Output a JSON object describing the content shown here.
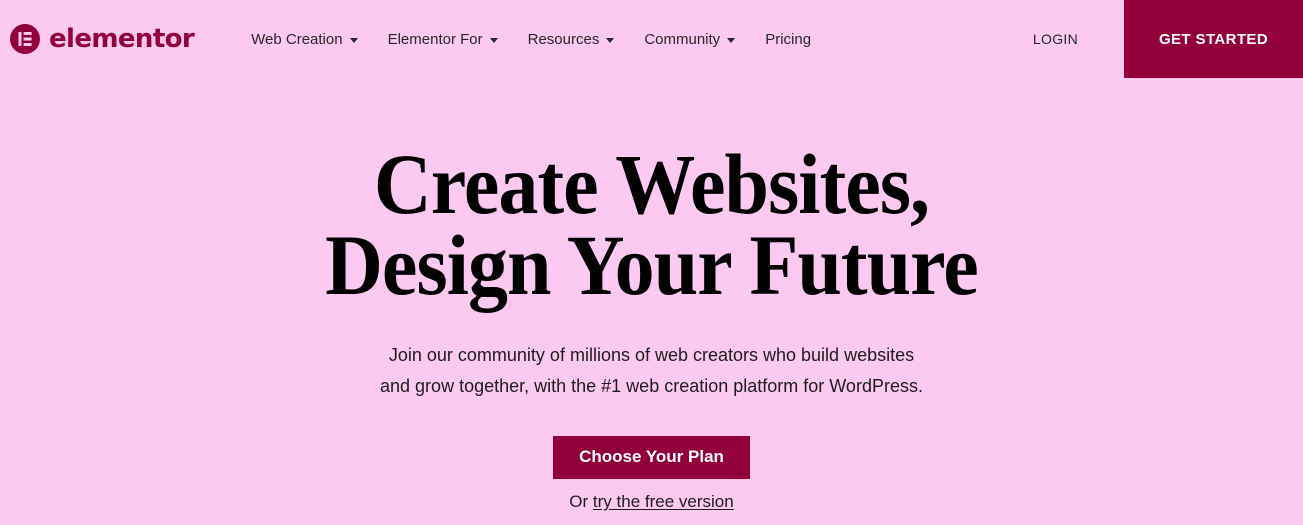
{
  "theme": {
    "background": "#fcc9f0",
    "brand_magenta": "#92003b",
    "text_dark": "#1c1c1c",
    "text_on_brand": "#ffffff"
  },
  "header": {
    "logo": {
      "icon": "elementor-logo-icon",
      "wordmark": "elementor"
    },
    "nav": [
      {
        "label": "Web Creation",
        "has_dropdown": true
      },
      {
        "label": "Elementor For",
        "has_dropdown": true
      },
      {
        "label": "Resources",
        "has_dropdown": true
      },
      {
        "label": "Community",
        "has_dropdown": true
      },
      {
        "label": "Pricing",
        "has_dropdown": false
      }
    ],
    "login_label": "LOGIN",
    "get_started_label": "GET STARTED"
  },
  "hero": {
    "headline_line1": "Create Websites,",
    "headline_line2": "Design Your Future",
    "subtitle_line1": "Join our community of millions of web creators who build websites",
    "subtitle_line2": "and grow together, with the #1 web creation platform for WordPress.",
    "cta_label": "Choose Your Plan",
    "free_prefix": "Or ",
    "free_link_label": "try the free version"
  }
}
